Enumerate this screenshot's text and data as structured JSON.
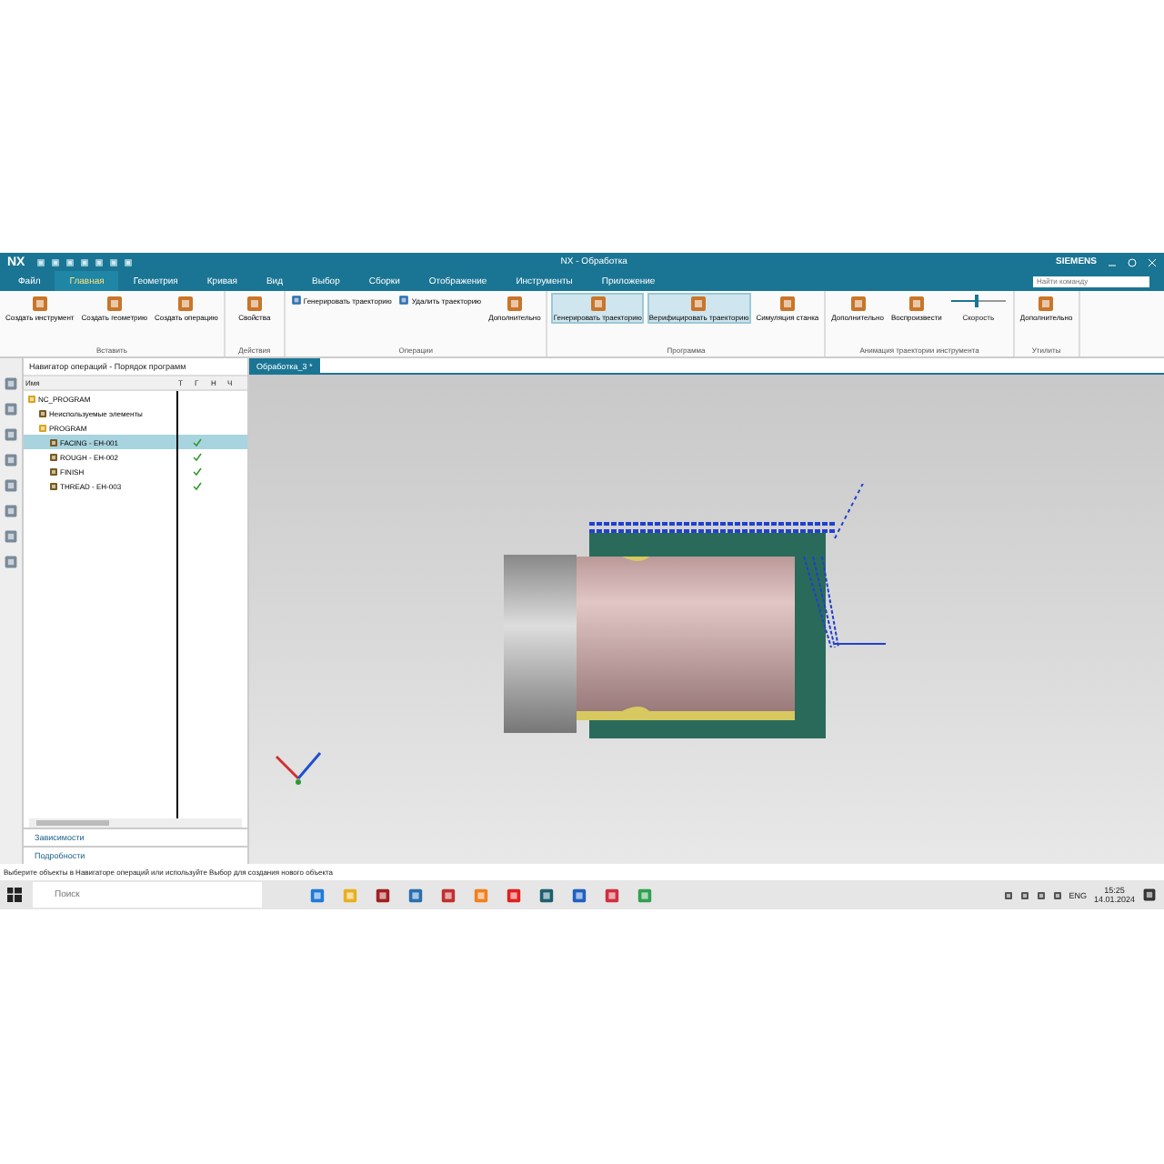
{
  "window": {
    "logo": "NX",
    "title": "NX - Обработка",
    "brand": "SIEMENS"
  },
  "menu_tabs": [
    {
      "label": "Файл",
      "selected": false
    },
    {
      "label": "Главная",
      "selected": true
    },
    {
      "label": "Геометрия",
      "selected": false
    },
    {
      "label": "Кривая",
      "selected": false
    },
    {
      "label": "Вид",
      "selected": false
    },
    {
      "label": "Выбор",
      "selected": false
    },
    {
      "label": "Сборки",
      "selected": false
    },
    {
      "label": "Отображение",
      "selected": false
    },
    {
      "label": "Инструменты",
      "selected": false
    },
    {
      "label": "Приложение",
      "selected": false
    }
  ],
  "command_search": {
    "placeholder": "Найти команду"
  },
  "ribbon_groups": [
    {
      "label": "Вставить",
      "items": [
        {
          "kind": "large",
          "label": "Создать инструмент",
          "selected": false
        },
        {
          "kind": "large",
          "label": "Создать геометрию",
          "selected": false
        },
        {
          "kind": "large",
          "label": "Создать операцию",
          "selected": false
        }
      ]
    },
    {
      "label": "Действия",
      "items": [
        {
          "kind": "large",
          "label": "Свойства",
          "selected": false
        }
      ]
    },
    {
      "label": "Операции",
      "items": [
        {
          "kind": "small",
          "label": "Генерировать траекторию",
          "selected": false
        },
        {
          "kind": "small",
          "label": "Удалить траекторию",
          "selected": false
        },
        {
          "kind": "large",
          "label": "Дополнительно",
          "selected": false
        }
      ]
    },
    {
      "label": "Программа",
      "items": [
        {
          "kind": "large",
          "label": "Генерировать траекторию",
          "selected": true
        },
        {
          "kind": "large",
          "label": "Верифицировать траекторию",
          "selected": true
        },
        {
          "kind": "large",
          "label": "Симуляция станка",
          "selected": false
        }
      ]
    },
    {
      "label": "Анимация траектории инструмента",
      "items": [
        {
          "kind": "large",
          "label": "Дополнительно",
          "selected": false
        },
        {
          "kind": "large",
          "label": "Воспроизвести",
          "selected": false
        },
        {
          "kind": "slider",
          "label": "Скорость",
          "level": 0.45,
          "selected": false
        }
      ]
    },
    {
      "label": "Утилиты",
      "items": [
        {
          "kind": "large",
          "label": "Дополнительно",
          "selected": false
        }
      ]
    }
  ],
  "navigator": {
    "title": "Навигатор операций - Порядок программ",
    "columns": [
      "Имя",
      "Т",
      "Г",
      "Н",
      "Ч"
    ],
    "tree": [
      {
        "name": "NC_PROGRAM",
        "selected": false,
        "generated": false,
        "children": [
          {
            "name": "Неиспользуемые элементы",
            "selected": false,
            "generated": false
          },
          {
            "name": "PROGRAM",
            "selected": false,
            "generated": false,
            "children": [
              {
                "name": "FACING - ЕН-001",
                "selected": true,
                "generated": true
              },
              {
                "name": "ROUGH - ЕН-002",
                "selected": false,
                "generated": true
              },
              {
                "name": "FINISH",
                "selected": false,
                "generated": true
              },
              {
                "name": "THREAD - ЕН-003",
                "selected": false,
                "generated": true
              }
            ]
          }
        ]
      }
    ],
    "sections": [
      "Зависимости",
      "Подробности"
    ]
  },
  "viewport": {
    "tab": "Обработка_3 *"
  },
  "status_line": "Выберите объекты в Навигаторе операций или используйте Выбор для создания нового объекта",
  "taskbar": {
    "search": {
      "placeholder": "Поиск"
    },
    "language": "ENG",
    "time": "15:25",
    "date": "14.01.2024"
  }
}
